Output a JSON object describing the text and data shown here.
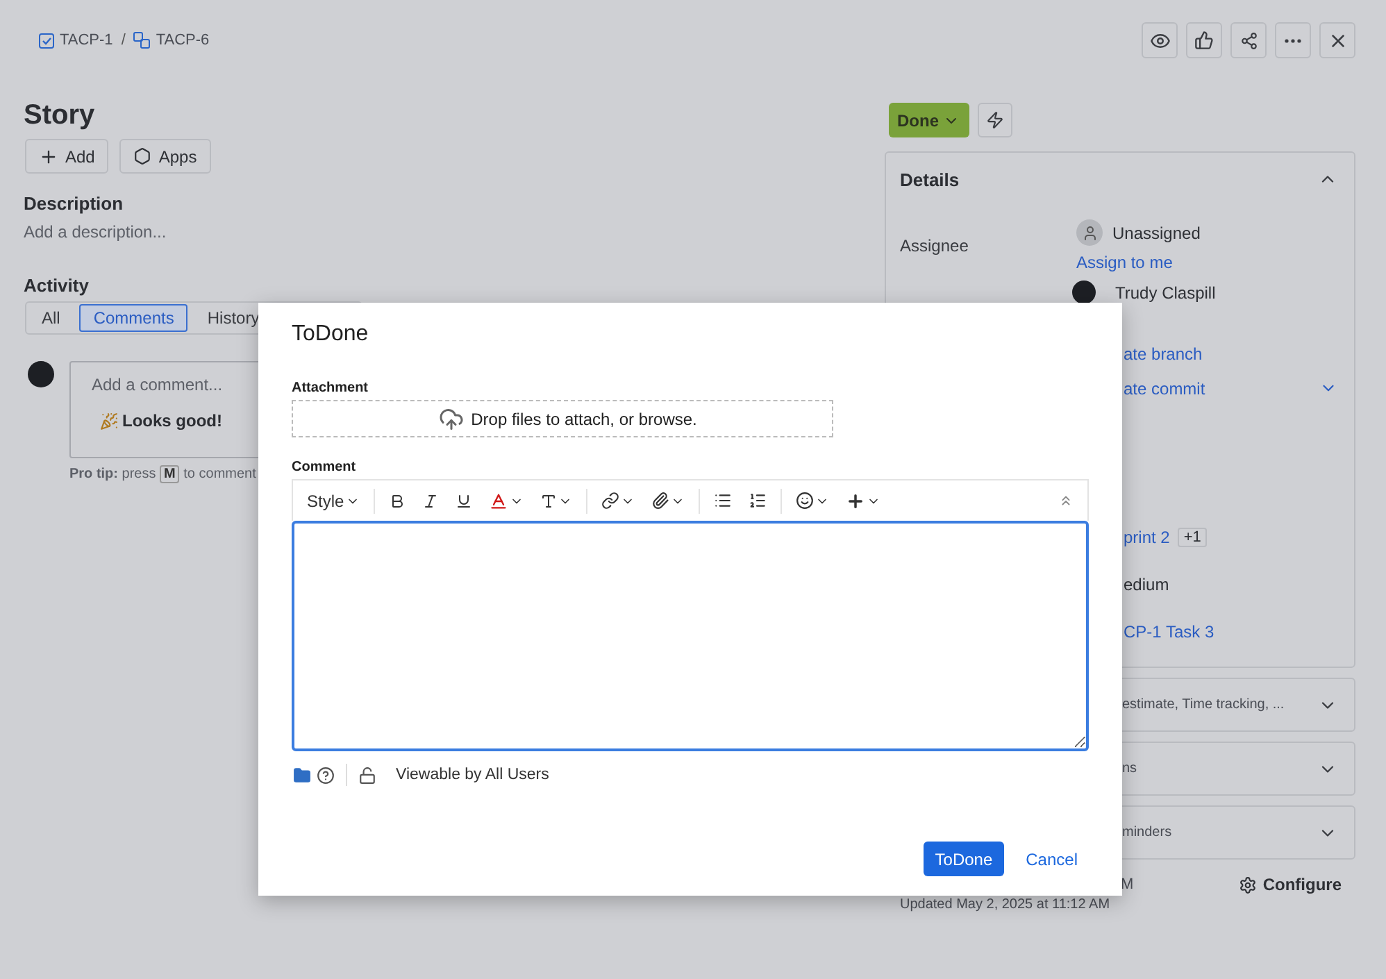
{
  "breadcrumbs": [
    {
      "label": "TACP-1",
      "kind": "story"
    },
    {
      "label": "TACP-6",
      "kind": "subtask"
    }
  ],
  "breadcrumb_separator": "/",
  "issue": {
    "title": "Story",
    "actions": [
      {
        "label": "Add",
        "kind": "add"
      },
      {
        "label": "Apps",
        "kind": "apps"
      }
    ]
  },
  "description": {
    "heading": "Description",
    "placeholder": "Add a description..."
  },
  "activity": {
    "heading": "Activity",
    "tabs": [
      {
        "label": "All",
        "selected": false
      },
      {
        "label": "Comments",
        "selected": true
      },
      {
        "label": "History",
        "selected": false
      }
    ],
    "comment_placeholder": "Add a comment...",
    "quick_replies": [
      "Looks good!"
    ],
    "pro_tip": {
      "lead": "Pro tip:",
      "before": "press",
      "key": "M",
      "after": "to comment"
    }
  },
  "status": {
    "label": "Done"
  },
  "details": {
    "title": "Details",
    "expanded": true,
    "assignee": {
      "label": "Assignee",
      "value": "Unassigned",
      "link": "Assign to me"
    },
    "reporter": "Trudy Claspill",
    "fragments": [
      {
        "text": "ate branch",
        "kind": "link"
      },
      {
        "text": "ate commit",
        "kind": "link",
        "expandable": true
      },
      {
        "text": "print 2",
        "kind": "link",
        "badge": "+1"
      },
      {
        "text": "edium",
        "kind": "text"
      },
      {
        "text": "CP-1 Task 3",
        "kind": "link"
      }
    ]
  },
  "sections": [
    {
      "label": "estimate, Time tracking, ...",
      "expanded": false
    },
    {
      "label": "ns",
      "expanded": false
    },
    {
      "label": "minders",
      "expanded": false
    }
  ],
  "created_fragment": "M",
  "configure": "Configure",
  "updated": "Updated May 2, 2025 at 11:12 AM",
  "dialog": {
    "title": "ToDone",
    "attachment": {
      "label": "Attachment",
      "dropzone": "Drop files to attach, or browse."
    },
    "comment": {
      "label": "Comment",
      "style_menu": "Style",
      "focused": true
    },
    "visibility": "Viewable by All Users",
    "buttons": [
      {
        "label": "ToDone",
        "kind": "primary"
      },
      {
        "label": "Cancel",
        "kind": "link"
      }
    ]
  }
}
